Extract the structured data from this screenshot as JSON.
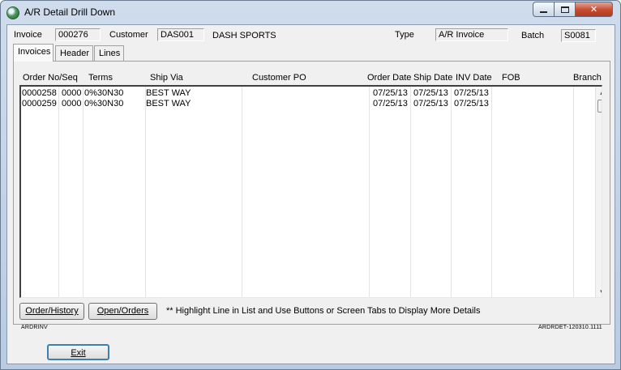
{
  "window": {
    "title": "A/R Detail Drill Down",
    "icon": "app-globe-icon",
    "controls": {
      "minimize": "minimize-icon",
      "maximize": "maximize-icon",
      "close": "close-icon"
    }
  },
  "header": {
    "invoice_label": "Invoice",
    "invoice_value": "000276",
    "customer_label": "Customer",
    "customer_value": "DAS001",
    "customer_name": "DASH SPORTS",
    "type_label": "Type",
    "type_value": "A/R Invoice",
    "batch_label": "Batch",
    "batch_value": "S0081"
  },
  "tabs": [
    {
      "label": "Invoices",
      "active": true
    },
    {
      "label": "Header",
      "active": false
    },
    {
      "label": "Lines",
      "active": false
    }
  ],
  "list": {
    "columns": [
      "Order No/Seq",
      "Terms",
      "Ship Via",
      "Customer PO",
      "Order Date",
      "Ship Date",
      "INV Date",
      "FOB",
      "Branch"
    ],
    "rows": [
      {
        "order_no": "0000258",
        "seq": "0000",
        "terms": "0%30N30",
        "ship_via": "BEST WAY",
        "customer_po": "",
        "order_date": "07/25/13",
        "ship_date": "07/25/13",
        "inv_date": "07/25/13",
        "fob": "",
        "branch": ""
      },
      {
        "order_no": "0000259",
        "seq": "0000",
        "terms": "0%30N30",
        "ship_via": "BEST WAY",
        "customer_po": "",
        "order_date": "07/25/13",
        "ship_date": "07/25/13",
        "inv_date": "07/25/13",
        "fob": "",
        "branch": ""
      }
    ]
  },
  "buttons": {
    "order_history": "Order/History",
    "open_orders": "Open/Orders",
    "exit": "Exit"
  },
  "hint": "**  Highlight Line in List and Use Buttons or Screen Tabs to Display More Details",
  "footer": {
    "left_code": "ARDRINV",
    "right_code": "ARDRDET-120310.1111"
  },
  "colors": {
    "frame": "#b9cbe2",
    "client_bg": "#f0f0f0",
    "close_button": "#c44a2f"
  }
}
